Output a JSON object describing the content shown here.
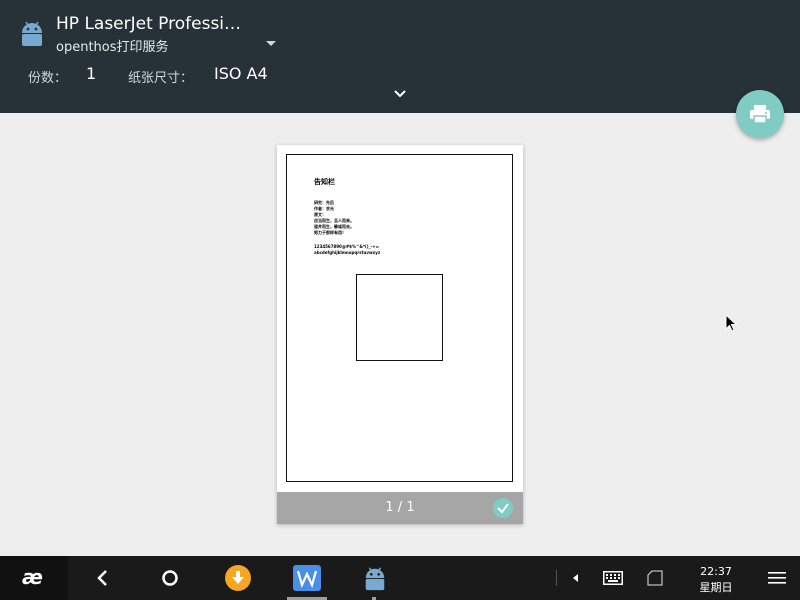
{
  "header": {
    "printer_name": "HP LaserJet Professi…",
    "printer_sub": "openthos打印服务",
    "copies_label": "份数：",
    "copies_value": "1",
    "paper_label": "纸张尺寸：",
    "paper_value": "ISO A4"
  },
  "preview": {
    "doc_title": "告知栏",
    "lines_group1": [
      "研究：先后",
      "作者：余光",
      "原文：",
      "应当而生，且人而来。",
      "道并而生，静谧而去。",
      "努力于那样有用！"
    ],
    "lines_group2": [
      "1234567890@#$%^&*()_-+=",
      "abcdefghijklmnopqrstuvwxyz"
    ],
    "page_indicator": "1 / 1"
  },
  "taskbar": {
    "start_label": "æ",
    "time": "22:37",
    "day": "星期日"
  },
  "icons": {
    "printer_avatar": "android-icon",
    "fab": "print-icon",
    "check": "check-circle-icon"
  },
  "colors": {
    "header_bg": "#263238",
    "fab_bg": "#80cbc4",
    "accent": "#80cbc4"
  }
}
